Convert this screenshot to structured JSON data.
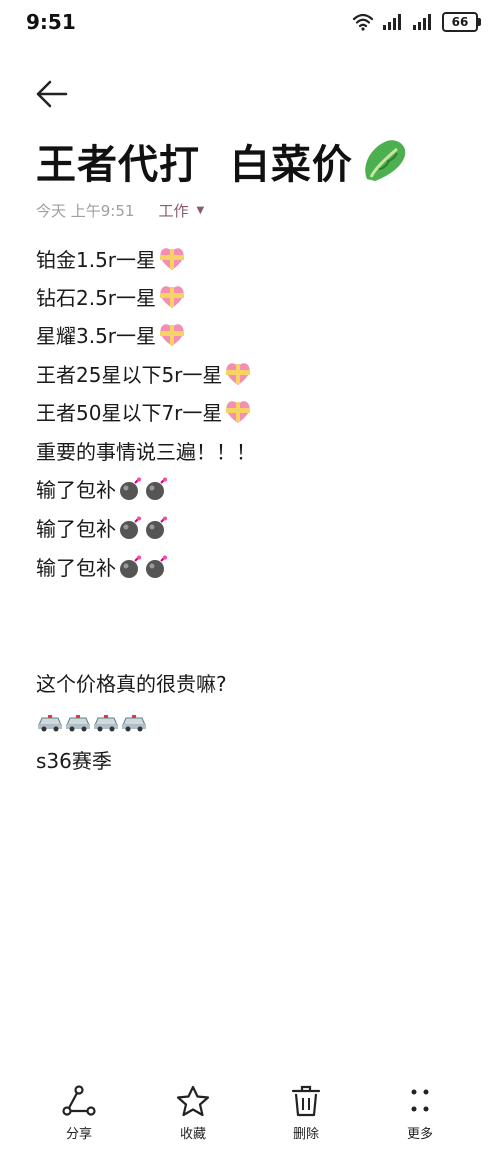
{
  "status_bar": {
    "time": "9:51",
    "battery": "66",
    "icons": [
      "wifi-icon",
      "signal-icon",
      "signal-icon",
      "battery-icon"
    ]
  },
  "note": {
    "title": "王者代打  白菜价",
    "title_emoji": "lettuce-icon",
    "meta": {
      "date": "今天 上午9:51",
      "folder": "工作"
    },
    "lines": [
      {
        "text": "铂金1.5r一星",
        "emoji": "heart-ribbon-icon",
        "count": 1
      },
      {
        "text": "钻石2.5r一星",
        "emoji": "heart-ribbon-icon",
        "count": 1
      },
      {
        "text": "星耀3.5r一星",
        "emoji": "heart-ribbon-icon",
        "count": 1
      },
      {
        "text": "王者25星以下5r一星",
        "emoji": "heart-ribbon-icon",
        "count": 1
      },
      {
        "text": "王者50星以下7r一星",
        "emoji": "heart-ribbon-icon",
        "count": 1
      },
      {
        "text": "重要的事情说三遍！！！",
        "emoji": "",
        "count": 0
      },
      {
        "text": "输了包补",
        "emoji": "bomb-icon",
        "count": 2
      },
      {
        "text": "输了包补",
        "emoji": "bomb-icon",
        "count": 2
      },
      {
        "text": "输了包补",
        "emoji": "bomb-icon",
        "count": 2
      }
    ],
    "question": "这个价格真的很贵嘛?",
    "cars_emoji": "police-car-icon",
    "cars_count": 4,
    "season": "s36赛季"
  },
  "toolbar": {
    "share": "分享",
    "favorite": "收藏",
    "delete": "删除",
    "more": "更多"
  }
}
